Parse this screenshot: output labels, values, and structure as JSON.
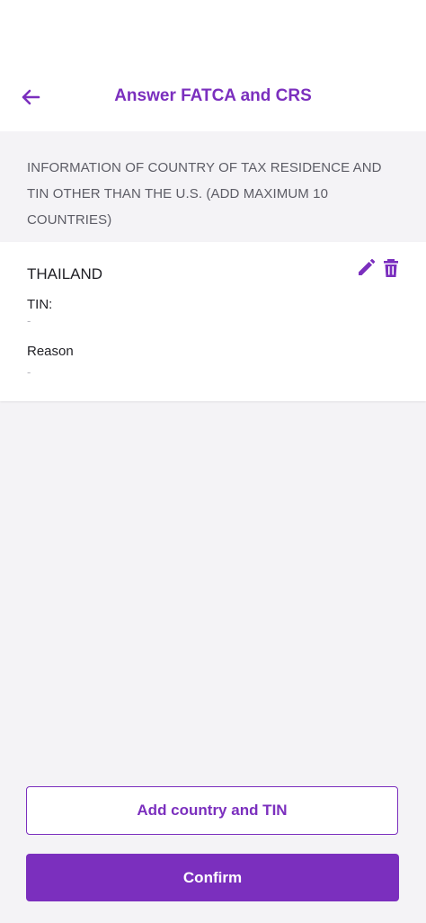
{
  "header": {
    "title": "Answer FATCA and CRS",
    "back_icon": "arrow-left-icon"
  },
  "section": {
    "description": "INFORMATION OF COUNTRY OF TAX RESIDENCE AND TIN OTHER THAN THE U.S. (ADD MAXIMUM 10 COUNTRIES)"
  },
  "countries": [
    {
      "name": "THAILAND",
      "tin_label": "TIN:",
      "tin_value": "-",
      "reason_label": "Reason",
      "reason_value": "-",
      "edit_icon": "pencil-icon",
      "delete_icon": "trash-icon"
    }
  ],
  "actions": {
    "add_label": "Add country and TIN",
    "confirm_label": "Confirm"
  },
  "colors": {
    "accent": "#7b2fbe",
    "background": "#f4f3f6",
    "card": "#ffffff"
  }
}
